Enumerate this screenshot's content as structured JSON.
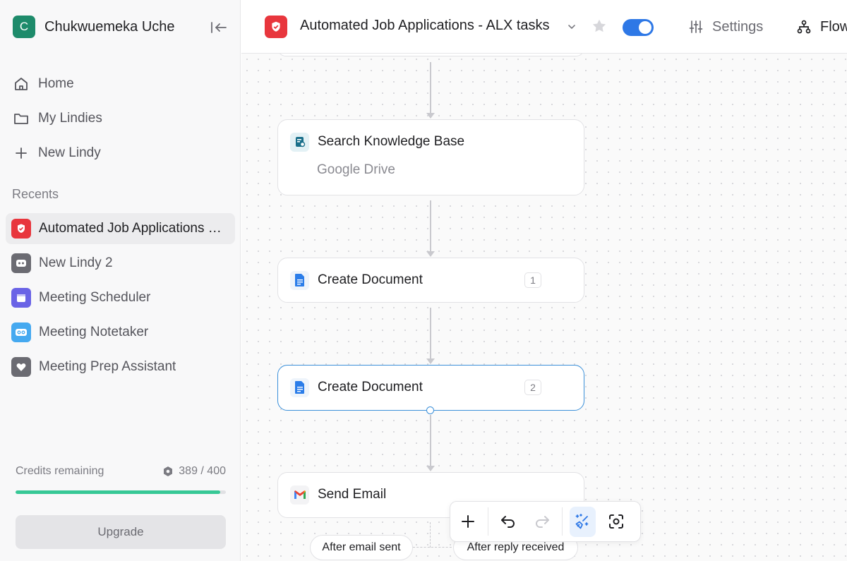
{
  "workspace": {
    "avatar_letter": "C",
    "name": "Chukwuemeka Uche"
  },
  "nav": {
    "home": "Home",
    "my_lindies": "My Lindies",
    "new_lindy": "New Lindy"
  },
  "recents": {
    "label": "Recents",
    "items": [
      {
        "label": "Automated Job Applications - ALX tasks",
        "color": "#e8363d",
        "active": true
      },
      {
        "label": "New Lindy 2",
        "color": "#6b6b72"
      },
      {
        "label": "Meeting Scheduler",
        "color": "#6a63e6"
      },
      {
        "label": "Meeting Notetaker",
        "color": "#45a9f0"
      },
      {
        "label": "Meeting Prep Assistant",
        "color": "#6b6b72"
      }
    ]
  },
  "credits": {
    "label": "Credits remaining",
    "value": "389 / 400",
    "used": 389,
    "total": 400
  },
  "upgrade_label": "Upgrade",
  "header": {
    "title": "Automated Job Applications - ALX tasks",
    "enabled": true,
    "settings_label": "Settings",
    "flow_label": "Flow"
  },
  "nodes": [
    {
      "title": "Search Knowledge Base",
      "subtitle": "Google Drive",
      "icon": "knowledge-base-icon"
    },
    {
      "title": "Create Document",
      "number": "1",
      "icon": "google-docs-icon"
    },
    {
      "title": "Create Document",
      "number": "2",
      "icon": "google-docs-icon",
      "selected": true
    },
    {
      "title": "Send Email",
      "icon": "gmail-icon"
    }
  ],
  "branches": {
    "left": "After email sent",
    "right": "After reply received"
  },
  "colors": {
    "accent": "#2e78e6",
    "progress": "#37c896",
    "selected_border": "#3a8fd9"
  }
}
